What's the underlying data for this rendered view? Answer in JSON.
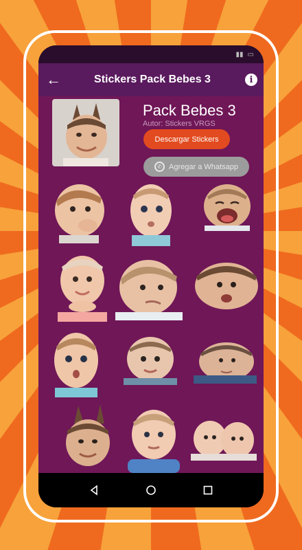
{
  "app": {
    "title": "Stickers Pack Bebes 3"
  },
  "pack": {
    "name": "Pack Bebes 3",
    "author": "Autor: Stickers VRGS",
    "download_label": "Descargar Stickers",
    "whatsapp_label": "Agregar a Whatsapp"
  },
  "icons": {
    "back": "arrow-left-icon",
    "info": "info-icon",
    "whatsapp": "whatsapp-icon",
    "nav_back": "triangle-back-icon",
    "nav_home": "circle-home-icon",
    "nav_recents": "square-recents-icon"
  },
  "colors": {
    "appbar": "#5a1a5e",
    "content_bg": "#6f1757",
    "download_button": "#e24a1f",
    "whatsapp_button": "#9c9c9c"
  }
}
